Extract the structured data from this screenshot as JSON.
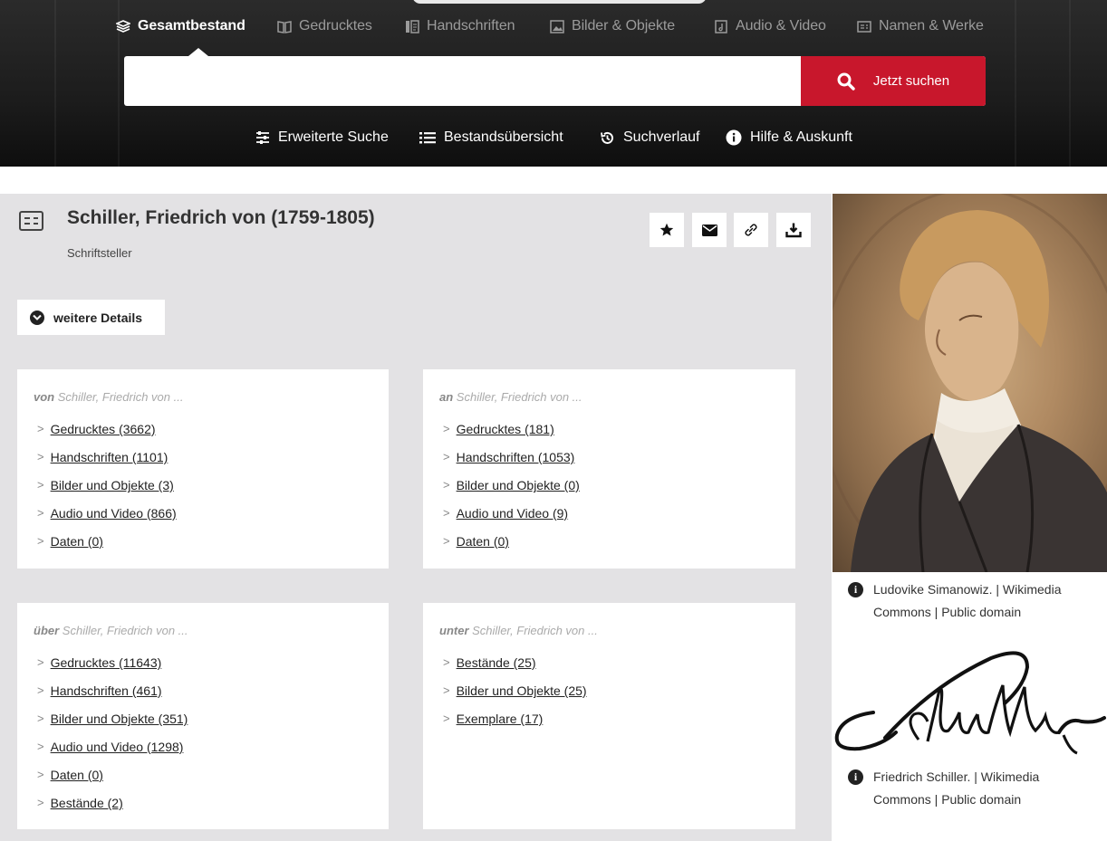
{
  "tabs": [
    {
      "label": "Gesamtbestand",
      "icon": "book-stack-icon",
      "active": true
    },
    {
      "label": "Gedrucktes",
      "icon": "open-book-icon",
      "active": false
    },
    {
      "label": "Handschriften",
      "icon": "manuscript-icon",
      "active": false
    },
    {
      "label": "Bilder & Objekte",
      "icon": "image-icon",
      "active": false
    },
    {
      "label": "Audio & Video",
      "icon": "audio-file-icon",
      "active": false
    },
    {
      "label": "Namen & Werke",
      "icon": "id-card-icon",
      "active": false
    }
  ],
  "search": {
    "value": "",
    "placeholder": "",
    "button_label": "Jetzt suchen",
    "button_icon": "search-icon"
  },
  "subnav": [
    {
      "label": "Erweiterte Suche",
      "icon": "sliders-icon"
    },
    {
      "label": "Bestandsübersicht",
      "icon": "list-icon"
    },
    {
      "label": "Suchverlauf",
      "icon": "history-icon"
    },
    {
      "label": "Hilfe & Auskunft",
      "icon": "info-icon"
    }
  ],
  "person": {
    "name": "Schiller, Friedrich von (1759-1805)",
    "role": "Schriftsteller",
    "icon": "id-card-icon"
  },
  "actions": [
    {
      "name": "bookmark",
      "icon": "star-icon"
    },
    {
      "name": "email",
      "icon": "envelope-icon"
    },
    {
      "name": "link",
      "icon": "link-icon"
    },
    {
      "name": "download",
      "icon": "download-icon"
    }
  ],
  "details_button": "weitere Details",
  "cards": [
    {
      "prefix": "von",
      "subject": "Schiller, Friedrich von ...",
      "items": [
        "Gedrucktes (3662)",
        "Handschriften (1101)",
        "Bilder und Objekte (3)",
        "Audio und Video (866)",
        "Daten (0)"
      ]
    },
    {
      "prefix": "an",
      "subject": "Schiller, Friedrich von ...",
      "items": [
        "Gedrucktes (181)",
        "Handschriften (1053)",
        "Bilder und Objekte (0)",
        "Audio und Video (9)",
        "Daten (0)"
      ]
    },
    {
      "prefix": "über",
      "subject": "Schiller, Friedrich von ...",
      "items": [
        "Gedrucktes (11643)",
        "Handschriften (461)",
        "Bilder und Objekte (351)",
        "Audio und Video (1298)",
        "Daten (0)",
        "Bestände (2)"
      ]
    },
    {
      "prefix": "unter",
      "subject": "Schiller, Friedrich von ...",
      "items": [
        "Bestände (25)",
        "Bilder und Objekte (25)",
        "Exemplare (17)"
      ]
    }
  ],
  "images": [
    {
      "caption": "Ludovike Simanowiz. | Wikimedia Commons | Public domain"
    },
    {
      "caption": "Friedrich Schiller. | Wikimedia Commons | Public domain"
    }
  ],
  "colors": {
    "accent": "#c8172c",
    "header_bg": "#1c1c1c",
    "main_bg": "#e3e2e4"
  }
}
